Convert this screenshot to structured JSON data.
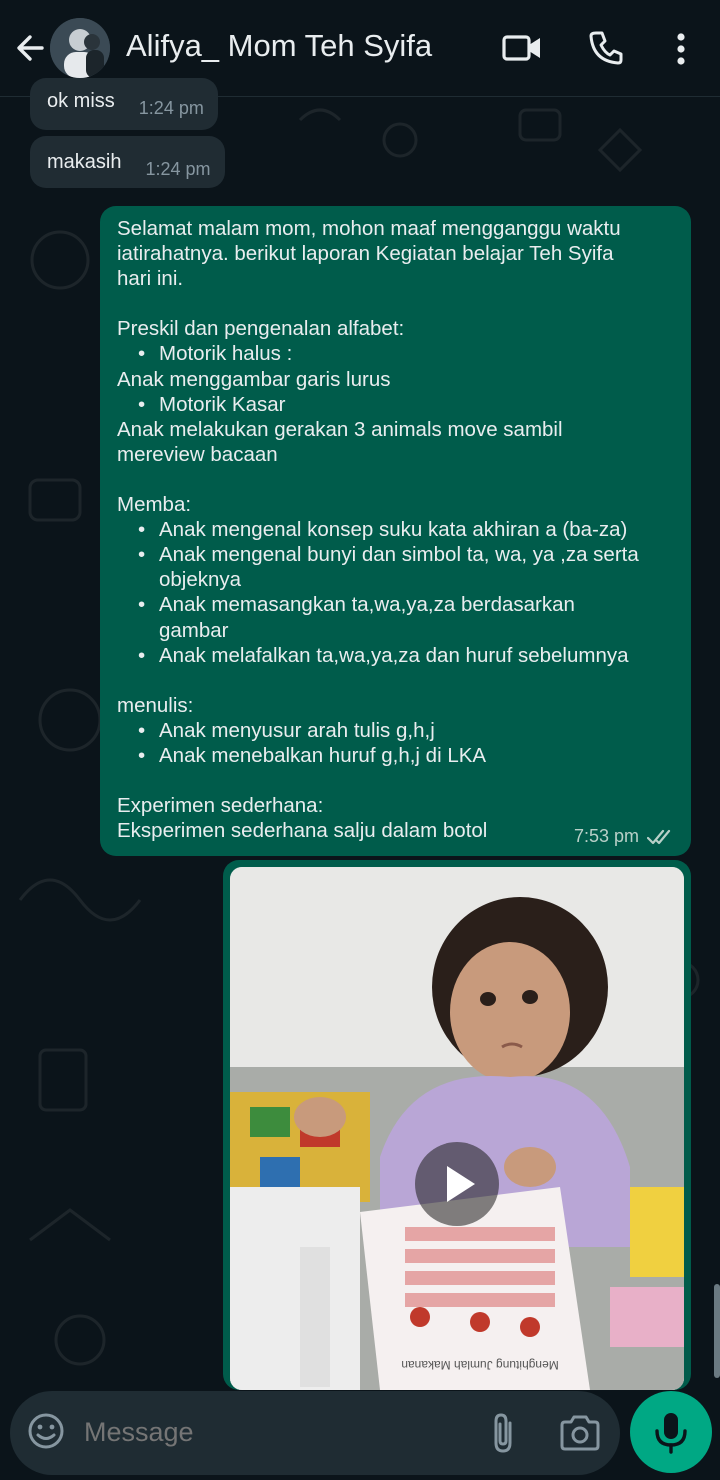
{
  "colors": {
    "background": "#0b141a",
    "incoming_bubble": "#202c33",
    "outgoing_bubble": "#005c4b",
    "accent_green": "#00a884",
    "muted_text": "#8696a0"
  },
  "header": {
    "back_icon": "arrow-left-icon",
    "contact_name": "Alifya_ Mom Teh Syifa",
    "icons": [
      "video-call-icon",
      "voice-call-icon",
      "more-vert-icon"
    ]
  },
  "messages": {
    "incoming": [
      {
        "text": "ok miss",
        "time": "1:24 pm"
      },
      {
        "text": "makasih",
        "time": "1:24 pm"
      }
    ],
    "outgoing": {
      "lines": {
        "l1": "Selamat malam mom, mohon maaf mengganggu waktu",
        "l2": "iatirahatnya. berikut laporan Kegiatan belajar Teh Syifa",
        "l3": "hari ini.",
        "l4": "Preskil dan pengenalan alfabet:",
        "b1": "Motorik halus :",
        "l5": "Anak menggambar garis lurus",
        "b2": "Motorik Kasar",
        "l6": "Anak melakukan gerakan 3 animals move sambil",
        "l7": "mereview bacaan",
        "l8": "Memba:",
        "b3": "Anak mengenal konsep suku kata akhiran a (ba-za)",
        "b4a": "Anak mengenal bunyi dan simbol ta, wa, ya ,za serta",
        "b4b": "objeknya",
        "b5a": "Anak memasangkan ta,wa,ya,za berdasarkan",
        "b5b": "gambar",
        "b6": "Anak melafalkan ta,wa,ya,za dan huruf sebelumnya",
        "l9": "menulis:",
        "b7": "Anak menyusur arah tulis g,h,j",
        "b8": "Anak menebalkan huruf g,h,j di LKA",
        "l10": "Experimen sederhana:",
        "l11": "Eksperimen sederhana salju dalam botol"
      },
      "time": "7:53 pm",
      "status_icon": "double-check-icon"
    },
    "video": {
      "play_icon": "play-icon",
      "worksheet_title": "Menghitung Jumlah Makanan"
    }
  },
  "input_bar": {
    "placeholder": "Message",
    "icons": [
      "emoji-icon",
      "attach-icon",
      "camera-icon",
      "mic-icon"
    ]
  }
}
